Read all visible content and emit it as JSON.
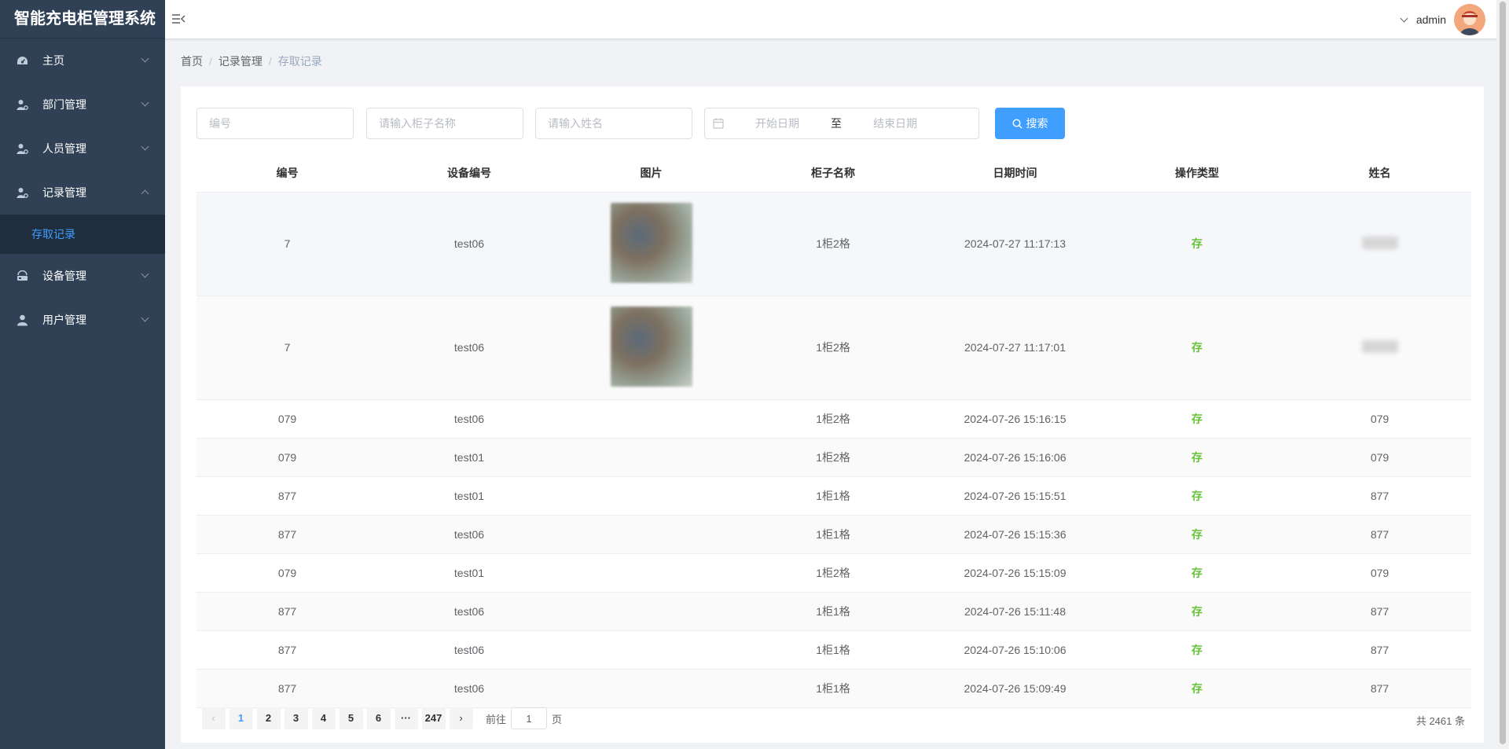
{
  "app": {
    "title": "智能充电柜管理系统"
  },
  "sidebar": {
    "items": [
      {
        "label": "主页",
        "icon": "dashboard-icon",
        "expanded": false
      },
      {
        "label": "部门管理",
        "icon": "user-gear-icon",
        "expanded": false
      },
      {
        "label": "人员管理",
        "icon": "user-gear-icon",
        "expanded": false
      },
      {
        "label": "记录管理",
        "icon": "user-gear-icon",
        "expanded": true
      },
      {
        "label": "设备管理",
        "icon": "device-icon",
        "expanded": false
      },
      {
        "label": "用户管理",
        "icon": "user-icon",
        "expanded": false
      }
    ],
    "submenu": {
      "label": "存取记录",
      "active": true
    }
  },
  "header": {
    "username": "admin"
  },
  "breadcrumb": [
    "首页",
    "记录管理",
    "存取记录"
  ],
  "filters": {
    "number_placeholder": "编号",
    "cabinet_placeholder": "请输入柜子名称",
    "name_placeholder": "请输入姓名",
    "start_placeholder": "开始日期",
    "range_separator": "至",
    "end_placeholder": "结束日期",
    "search_label": "搜索"
  },
  "table": {
    "columns": [
      "编号",
      "设备编号",
      "图片",
      "柜子名称",
      "日期时间",
      "操作类型",
      "姓名"
    ],
    "rows": [
      {
        "number": "7",
        "device": "test06",
        "has_image": true,
        "cabinet": "1柜2格",
        "datetime": "2024-07-27 11:17:13",
        "op": "存",
        "name": ""
      },
      {
        "number": "7",
        "device": "test06",
        "has_image": true,
        "cabinet": "1柜2格",
        "datetime": "2024-07-27 11:17:01",
        "op": "存",
        "name": ""
      },
      {
        "number": "079",
        "device": "test06",
        "has_image": false,
        "cabinet": "1柜2格",
        "datetime": "2024-07-26 15:16:15",
        "op": "存",
        "name": "079"
      },
      {
        "number": "079",
        "device": "test01",
        "has_image": false,
        "cabinet": "1柜2格",
        "datetime": "2024-07-26 15:16:06",
        "op": "存",
        "name": "079"
      },
      {
        "number": "877",
        "device": "test01",
        "has_image": false,
        "cabinet": "1柜1格",
        "datetime": "2024-07-26 15:15:51",
        "op": "存",
        "name": "877"
      },
      {
        "number": "877",
        "device": "test06",
        "has_image": false,
        "cabinet": "1柜1格",
        "datetime": "2024-07-26 15:15:36",
        "op": "存",
        "name": "877"
      },
      {
        "number": "079",
        "device": "test01",
        "has_image": false,
        "cabinet": "1柜2格",
        "datetime": "2024-07-26 15:15:09",
        "op": "存",
        "name": "079"
      },
      {
        "number": "877",
        "device": "test06",
        "has_image": false,
        "cabinet": "1柜1格",
        "datetime": "2024-07-26 15:11:48",
        "op": "存",
        "name": "877"
      },
      {
        "number": "877",
        "device": "test06",
        "has_image": false,
        "cabinet": "1柜1格",
        "datetime": "2024-07-26 15:10:06",
        "op": "存",
        "name": "877"
      },
      {
        "number": "877",
        "device": "test06",
        "has_image": false,
        "cabinet": "1柜1格",
        "datetime": "2024-07-26 15:09:49",
        "op": "存",
        "name": "877"
      }
    ]
  },
  "pagination": {
    "pages": [
      "1",
      "2",
      "3",
      "4",
      "5",
      "6"
    ],
    "active_page": "1",
    "ellipsis": "···",
    "last_page": "247",
    "goto_prefix": "前往",
    "goto_value": "1",
    "goto_suffix": "页",
    "total_text": "共 2461 条"
  },
  "colors": {
    "sidebar_bg": "#304156",
    "accent": "#409eff",
    "op_green": "#67c23a"
  }
}
